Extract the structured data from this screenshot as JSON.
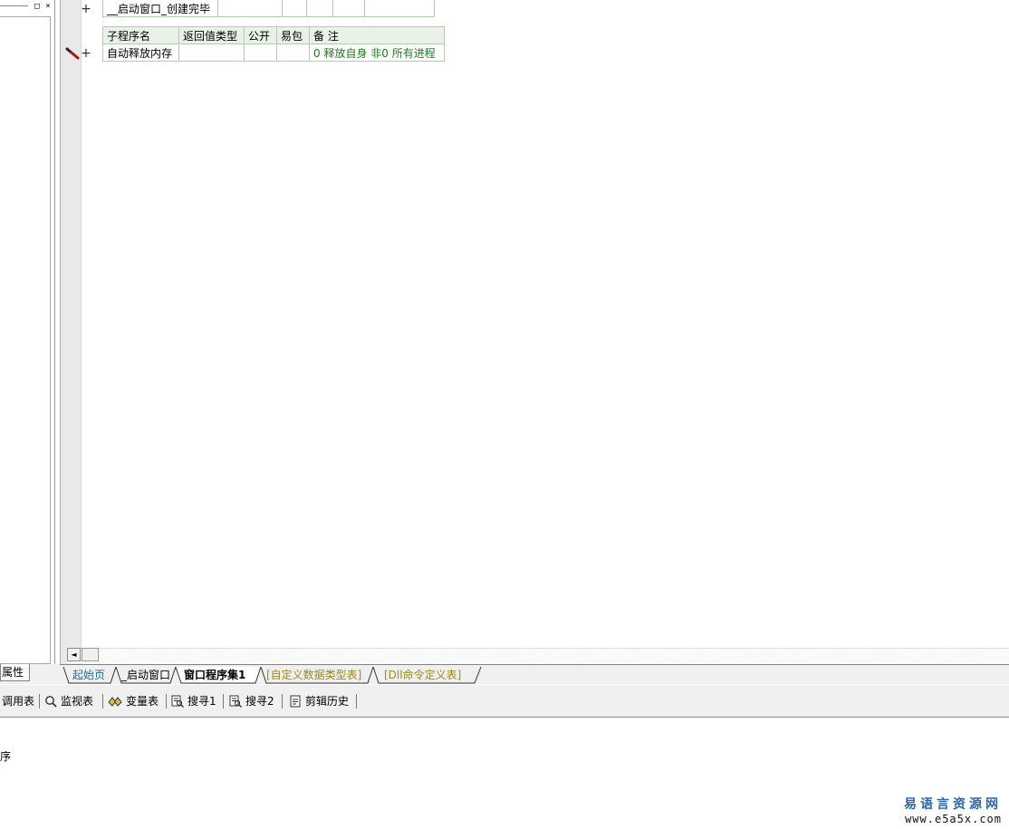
{
  "left_panel": {
    "restore_glyph": "□",
    "close_glyph": "×",
    "tab_label": "属性"
  },
  "event_table": {
    "rows": [
      {
        "name": "__启动窗口_创建完毕"
      }
    ]
  },
  "sub_table": {
    "headers": [
      "子程序名",
      "返回值类型",
      "公开",
      "易包",
      "备 注"
    ],
    "rows": [
      {
        "name": "自动释放内存",
        "return_type": "",
        "public": "",
        "package": "",
        "remark": "0 释放自身 非0 所有进程"
      }
    ]
  },
  "scrollbar": {
    "left_arrow": "◄"
  },
  "doc_tabs": [
    {
      "label": "起始页"
    },
    {
      "label": "_启动窗口"
    },
    {
      "label": "窗口程序集1"
    },
    {
      "label": "[自定义数据类型表]"
    },
    {
      "label": "[Dll命令定义表]"
    }
  ],
  "toolbar": {
    "items": [
      {
        "label": "调用表",
        "icon": ""
      },
      {
        "label": "监视表",
        "icon": "magnifier-icon"
      },
      {
        "label": "变量表",
        "icon": "variables-icon"
      },
      {
        "label": "搜寻1",
        "icon": "search-list-icon"
      },
      {
        "label": "搜寻2",
        "icon": "search-list-icon"
      },
      {
        "label": "剪辑历史",
        "icon": "clipboard-icon"
      }
    ]
  },
  "output": {
    "text": "序"
  },
  "watermark": {
    "line1": "易语言资源网",
    "line2": "www.e5a5x.com"
  },
  "colors": {
    "remark_green": "#1f7d1f",
    "start_tab_blue": "#1a6aa8",
    "olive_tab": "#9a8a1a",
    "header_bg": "#e8f2e6"
  }
}
